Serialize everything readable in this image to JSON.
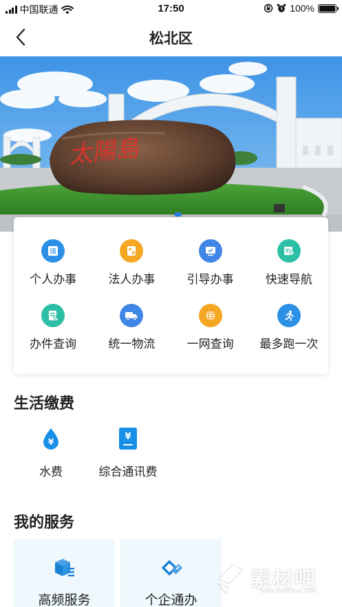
{
  "status_bar": {
    "carrier": "中国联通",
    "time": "17:50",
    "battery": "100%"
  },
  "header": {
    "title": "松北区"
  },
  "banner": {
    "stone_text": "太陽島",
    "slide_count": 1,
    "active_slide": 1
  },
  "services": [
    {
      "label": "个人办事",
      "icon": "list-icon",
      "color": "#2b90e6"
    },
    {
      "label": "法人办事",
      "icon": "id-card-icon",
      "color": "#f5a623"
    },
    {
      "label": "引导办事",
      "icon": "monitor-icon",
      "color": "#3f86e6"
    },
    {
      "label": "快速导航",
      "icon": "map-pin-icon",
      "color": "#2dbfa6"
    },
    {
      "label": "办件查询",
      "icon": "document-search-icon",
      "color": "#2dbfa6"
    },
    {
      "label": "统一物流",
      "icon": "truck-icon",
      "color": "#3f86e6"
    },
    {
      "label": "一网查询",
      "icon": "globe-icon",
      "color": "#f5a623"
    },
    {
      "label": "最多跑一次",
      "icon": "runner-icon",
      "color": "#2b90e6"
    }
  ],
  "life_section": {
    "title": "生活缴费",
    "items": [
      {
        "label": "水费",
        "icon": "water-drop-icon"
      },
      {
        "label": "综合通讯费",
        "icon": "phone-bill-icon"
      }
    ]
  },
  "my_section": {
    "title": "我的服务",
    "items": [
      {
        "label": "高频服务",
        "icon": "cube-list-icon"
      },
      {
        "label": "个企通办",
        "icon": "tag-icon"
      }
    ]
  },
  "watermark": {
    "text": "素材吧",
    "sub": "www.sucaibar.com"
  }
}
